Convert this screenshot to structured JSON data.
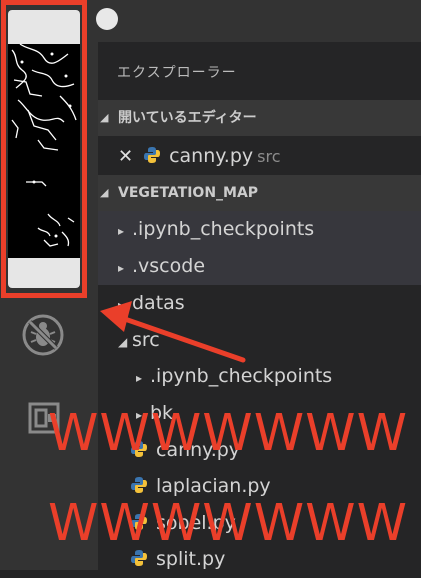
{
  "explorer_title": "エクスプローラー",
  "open_editors": {
    "header": "開いているエディター",
    "items": [
      {
        "name": "canny.py",
        "folder": "src"
      }
    ]
  },
  "project": {
    "header": "VEGETATION_MAP",
    "items": [
      {
        "name": ".ipynb_checkpoints",
        "type": "folder"
      },
      {
        "name": ".vscode",
        "type": "folder"
      },
      {
        "name": "datas",
        "type": "folder"
      },
      {
        "name": "src",
        "type": "folder",
        "expanded": true
      },
      {
        "name": ".ipynb_checkpoints",
        "type": "folder"
      },
      {
        "name": "bk",
        "type": "folder"
      },
      {
        "name": "canny.py",
        "type": "python"
      },
      {
        "name": "laplacian.py",
        "type": "python"
      },
      {
        "name": "sobel.py",
        "type": "python"
      },
      {
        "name": "split.py",
        "type": "python"
      }
    ]
  },
  "overlay_text": [
    "WWWWWWW",
    "WWWWWWW"
  ],
  "colors": {
    "annotation_red": "#ea3f2a",
    "sidebar_bg": "#252526",
    "activity_bg": "#333333",
    "python_blue": "#3a75b0",
    "python_yellow": "#f3c13a"
  }
}
